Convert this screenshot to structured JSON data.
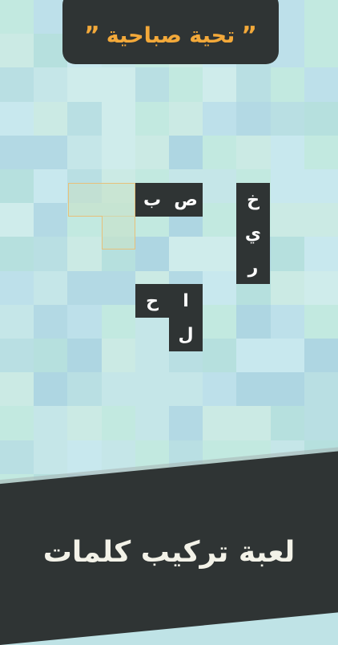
{
  "title": {
    "open_quote": "”",
    "text": "تحية صباحية",
    "close_quote": "”"
  },
  "footer": {
    "text": "لعبة تركيب كلمات"
  },
  "colors": {
    "tile": "#2f3434",
    "accent": "#f3a93a",
    "ghost_border": "#e7c07a"
  },
  "tiles": [
    {
      "name": "tile-sad",
      "letter": "ص"
    },
    {
      "name": "tile-ba",
      "letter": "ب"
    },
    {
      "name": "tile-kha",
      "letter": "خ"
    },
    {
      "name": "tile-ya",
      "letter": "ي"
    },
    {
      "name": "tile-ra",
      "letter": "ر"
    },
    {
      "name": "tile-alef",
      "letter": "ا"
    },
    {
      "name": "tile-ha",
      "letter": "ح"
    },
    {
      "name": "tile-lam",
      "letter": "ل"
    }
  ]
}
